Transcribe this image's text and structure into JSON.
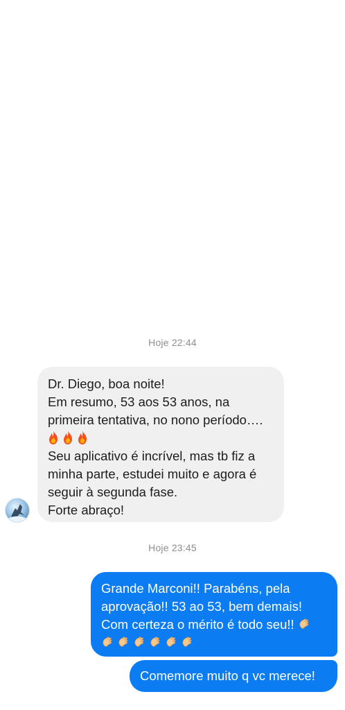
{
  "conversation": {
    "first_timestamp": "Hoje 22:44",
    "second_timestamp": "Hoje 23:45"
  },
  "incoming_message": {
    "lines": [
      "Dr. Diego, boa noite!",
      "Em resumo, 53 aos 53 anos, na",
      "primeira tentativa, no nono período…."
    ],
    "emoji": [
      "fire-emoji",
      "fire-emoji",
      "fire-emoji"
    ],
    "lines_after": [
      "Seu aplicativo é incrível, mas tb fiz a",
      "minha parte, estudei muito e agora é",
      "seguir à segunda fase.",
      "Forte abraço!"
    ],
    "bubble_color": "#f0f0f0"
  },
  "outgoing_messages": {
    "first_lines": [
      "Grande Marconi!! Parabéns, pela",
      "aprovação!! 53 ao 53, bem demais!",
      "Com certeza o mérito é todo seu!!"
    ],
    "clap_emoji": "clapping-hands-emoji",
    "clap_count": 7,
    "second": "Comemore muito q vc merece!",
    "bubble_color": "#0b7cf2"
  }
}
